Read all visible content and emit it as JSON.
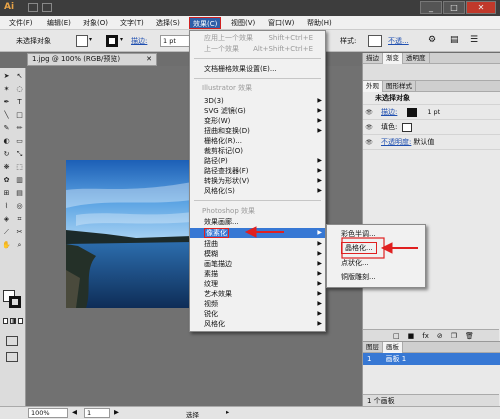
{
  "app": {
    "logo": "Ai"
  },
  "window_buttons": {
    "minimize": "_",
    "maximize": "□",
    "close": "✕"
  },
  "menu_bar": {
    "items": [
      "文件(F)",
      "编辑(E)",
      "对象(O)",
      "文字(T)",
      "选择(S)",
      "效果(C)",
      "视图(V)",
      "窗口(W)",
      "帮助(H)"
    ],
    "active_index": 5
  },
  "control_bar": {
    "selection_label": "未选择对象",
    "stroke_label": "描边:",
    "stroke_value": "1 pt",
    "style_label": "样式:",
    "opacity_label": "不透..."
  },
  "document": {
    "tab_title": "1.jpg @ 100% (RGB/预览)",
    "tab_close": "✕"
  },
  "effect_menu": {
    "apply_last": "应用上一个效果",
    "apply_last_shortcut": "Shift+Ctrl+E",
    "last_effect": "上一个效果",
    "last_effect_shortcut": "Alt+Shift+Ctrl+E",
    "raster_settings": "文档栅格效果设置(E)...",
    "illustrator_header": "Illustrator 效果",
    "illustrator_items": [
      "3D(3)",
      "SVG 滤镜(G)",
      "变形(W)",
      "扭曲和变换(D)",
      "栅格化(R)...",
      "裁剪标记(O)",
      "路径(P)",
      "路径查找器(F)",
      "转换为形状(V)",
      "风格化(S)"
    ],
    "photoshop_header": "Photoshop 效果",
    "gallery": "效果画廊...",
    "photoshop_items": [
      "像素化",
      "扭曲",
      "模糊",
      "画笔描边",
      "素描",
      "纹理",
      "艺术效果",
      "视频",
      "锐化",
      "风格化"
    ],
    "highlighted_item": "像素化"
  },
  "pixelate_submenu": {
    "items": [
      "彩色半调...",
      "晶格化...",
      "点状化...",
      "铜版雕刻..."
    ],
    "boxed_item": "晶格化..."
  },
  "appearance_panel": {
    "top_tabs": [
      "描边",
      "渐变",
      "透明度"
    ],
    "tabs": [
      "外观",
      "图形样式"
    ],
    "title": "未选择对象",
    "stroke_label": "描边:",
    "stroke_value": "1 pt",
    "fill_label": "填色:",
    "opacity_label": "不透明度:",
    "opacity_value": "默认值"
  },
  "layers_panel": {
    "tabs": [
      "图层",
      "画板"
    ],
    "row_index": "1",
    "row_name": "画板 1",
    "footer_count": "1 个画板"
  },
  "status_bar": {
    "zoom": "100%",
    "page": "1",
    "tool": "选择"
  },
  "colors": {
    "menu_highlight": "#3778d4",
    "annotation_red": "#e02020",
    "menubar_active": "#2f5fa8"
  }
}
